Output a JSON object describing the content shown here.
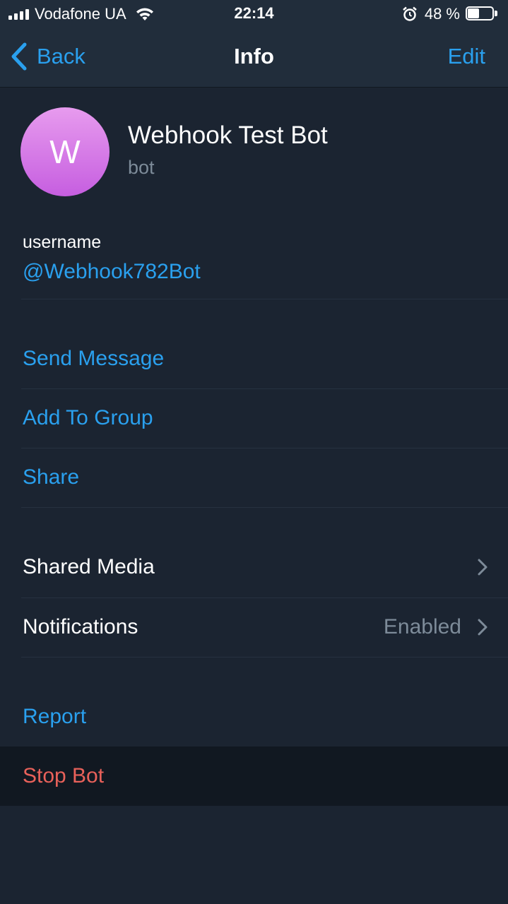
{
  "status_bar": {
    "carrier": "Vodafone UA",
    "time": "22:14",
    "battery_percent": "48 %",
    "battery_level": 0.48,
    "icons": [
      "signal-icon",
      "wifi-icon",
      "alarm-icon",
      "battery-icon"
    ]
  },
  "nav": {
    "back_label": "Back",
    "title": "Info",
    "edit_label": "Edit"
  },
  "profile": {
    "avatar_letter": "W",
    "name": "Webhook Test Bot",
    "subtitle": "bot",
    "avatar_colors": [
      "#e79bee",
      "#c65ee0"
    ]
  },
  "username": {
    "label": "username",
    "value": "@Webhook782Bot"
  },
  "actions": {
    "send_message": "Send Message",
    "add_to_group": "Add To Group",
    "share": "Share"
  },
  "settings": {
    "shared_media": "Shared Media",
    "notifications": "Notifications",
    "notifications_value": "Enabled"
  },
  "danger": {
    "report": "Report",
    "stop_bot": "Stop Bot"
  },
  "colors": {
    "accent": "#2aa0ee",
    "destructive": "#e8615a",
    "background": "#1b2431",
    "bar": "#212d3b"
  }
}
